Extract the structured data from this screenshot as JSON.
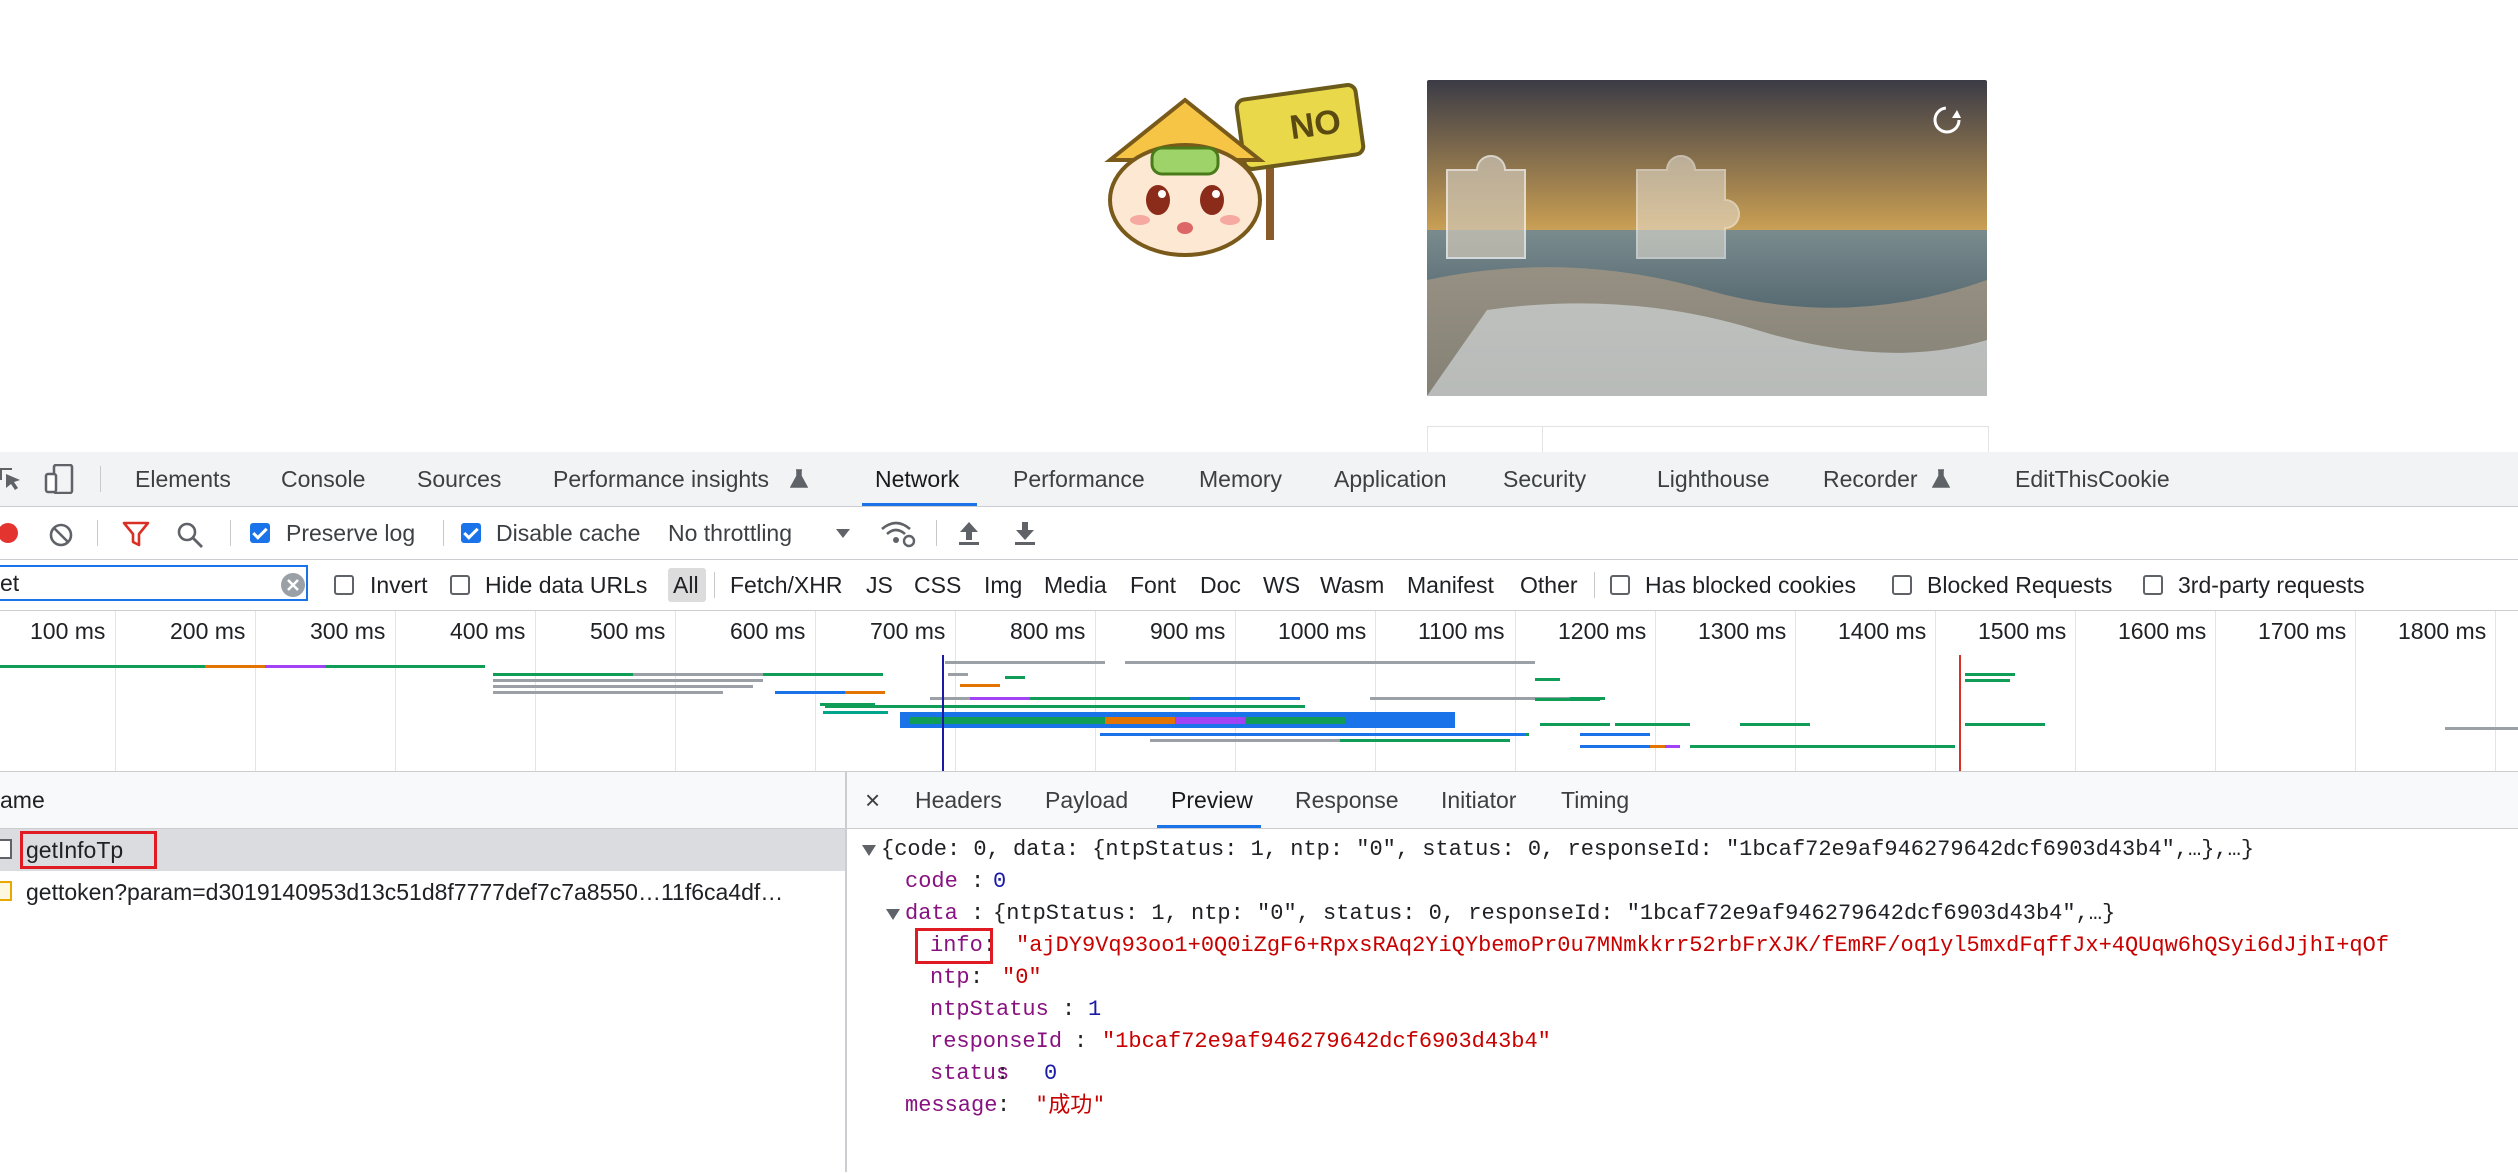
{
  "devtools": {
    "tabs": [
      "Elements",
      "Console",
      "Sources",
      "Performance insights",
      "Network",
      "Performance",
      "Memory",
      "Application",
      "Security",
      "Lighthouse",
      "Recorder",
      "EditThisCookie"
    ],
    "active_tab": "Network"
  },
  "toolbar": {
    "preserve_log": "Preserve log",
    "preserve_log_checked": true,
    "disable_cache": "Disable cache",
    "disable_cache_checked": true,
    "throttling": "No throttling"
  },
  "filter": {
    "value": "et",
    "invert": "Invert",
    "hide_data_urls": "Hide data URLs",
    "types": [
      "All",
      "Fetch/XHR",
      "JS",
      "CSS",
      "Img",
      "Media",
      "Font",
      "Doc",
      "WS",
      "Wasm",
      "Manifest",
      "Other"
    ],
    "active_type": "All",
    "has_blocked_cookies": "Has blocked cookies",
    "blocked_requests": "Blocked Requests",
    "third_party": "3rd-party requests"
  },
  "timeline": {
    "ticks": [
      "100 ms",
      "200 ms",
      "300 ms",
      "400 ms",
      "500 ms",
      "600 ms",
      "700 ms",
      "800 ms",
      "900 ms",
      "1000 ms",
      "1100 ms",
      "1200 ms",
      "1300 ms",
      "1400 ms",
      "1500 ms",
      "1600 ms",
      "1700 ms",
      "1800 ms"
    ],
    "colors": {
      "green": "#0f9d58",
      "orange": "#e37400",
      "purple": "#a142f4",
      "gray": "#9aa0a6",
      "blue": "#1a73e8",
      "teal": "#00a58c",
      "red": "#d93025"
    }
  },
  "name_panel": {
    "header": "ame",
    "rows": [
      {
        "name": "getInfoTp",
        "selected": true
      },
      {
        "name": "gettoken?param=d3019140953d13c51d8f7777def7c7a8550…11f6ca4df…",
        "selected": false
      }
    ]
  },
  "preview": {
    "tabs": [
      "Headers",
      "Payload",
      "Preview",
      "Response",
      "Initiator",
      "Timing"
    ],
    "active_tab": "Preview",
    "close": "×",
    "summary": "{code: 0, data: {ntpStatus: 1, ntp: \"0\", status: 0, responseId: \"1bcaf72e9af946279642dcf6903d43b4\",…},…}",
    "code_key": "code",
    "code_val": "0",
    "data_key": "data",
    "data_summary": "{ntpStatus: 1, ntp: \"0\", status: 0, responseId: \"1bcaf72e9af946279642dcf6903d43b4\",…}",
    "info_key": "info",
    "info_val": "\"ajDY9Vq93oo1+0Q0iZgF6+RpxsRAq2YiQYbemoPr0u7MNmkkrr52rbFrXJK/fEmRF/oq1yl5mxdFqffJx+4QUqw6hQSyi6dJjhI+qOf",
    "ntp_key": "ntp",
    "ntp_val": "\"0\"",
    "ntpStatus_key": "ntpStatus",
    "ntpStatus_val": "1",
    "responseId_key": "responseId",
    "responseId_val": "\"1bcaf72e9af946279642dcf6903d43b4\"",
    "status_key": "status",
    "status_val": "0",
    "message_key": "message",
    "message_val": "\"成功\""
  },
  "captcha": {
    "mascot_sign": "NO"
  }
}
